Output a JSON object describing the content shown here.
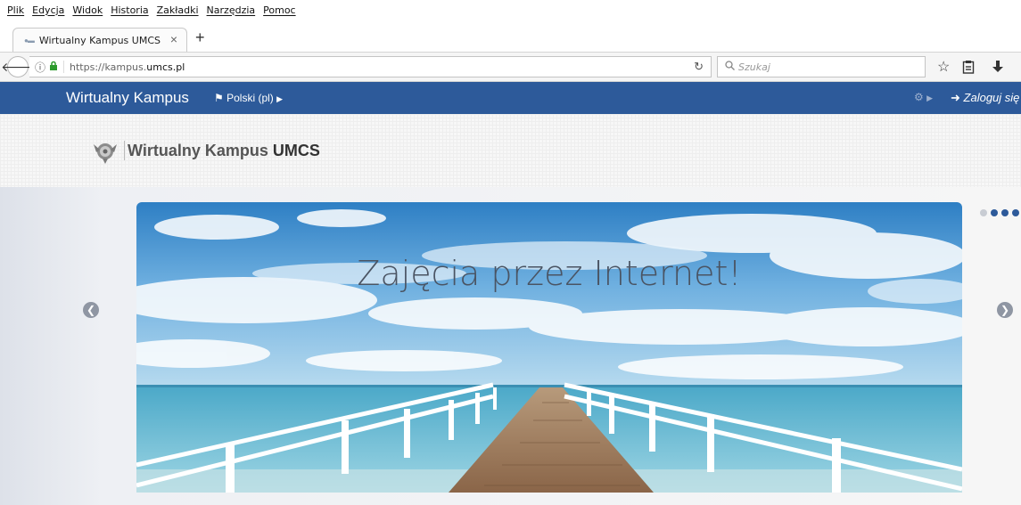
{
  "menubar": {
    "items": [
      "Plik",
      "Edycja",
      "Widok",
      "Historia",
      "Zakładki",
      "Narzędzia",
      "Pomoc"
    ]
  },
  "tab": {
    "title": "Wirtualny Kampus UMCS",
    "close_label": "×",
    "new_tab_label": "+"
  },
  "navbar": {
    "url_prefix": "https://kampus.",
    "url_domain": "umcs.pl",
    "search_placeholder": "Szukaj"
  },
  "site": {
    "name": "Wirtualny Kampus",
    "language": "Polski (pl)",
    "login": "Zaloguj się",
    "brand_color": "#2d5a9a"
  },
  "logo": {
    "text_main": "Wirtualny Kampus",
    "text_strong": "UMCS"
  },
  "carousel": {
    "caption": "Zajęcia przez Internet!",
    "slide_count": 4,
    "active_slide": 2,
    "indicator_inactive_color": "#c8ccd3",
    "indicator_active_color": "#2d5a9a"
  },
  "icons": {
    "back": "back-arrow-icon",
    "info": "info-icon",
    "lock": "lock-icon",
    "reload": "reload-icon",
    "search": "magnifier-icon",
    "bookmark": "star-icon",
    "library": "clipboard-icon",
    "download": "download-icon",
    "flag": "flag-icon",
    "gear": "gear-icon",
    "login": "sign-in-icon"
  }
}
